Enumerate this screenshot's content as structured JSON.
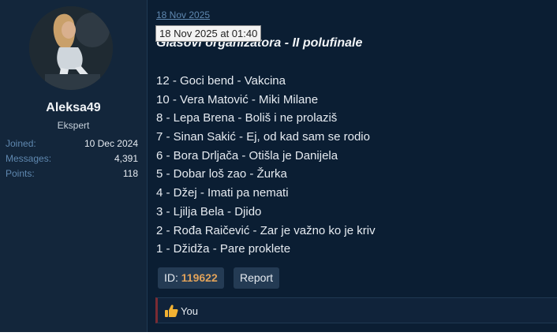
{
  "user": {
    "username": "Aleksa49",
    "title": "Ekspert",
    "stats": [
      {
        "label": "Joined:",
        "value": "10 Dec 2024"
      },
      {
        "label": "Messages:",
        "value": "4,391"
      },
      {
        "label": "Points:",
        "value": "118"
      }
    ]
  },
  "post": {
    "date": "18 Nov 2025",
    "tooltip": "18 Nov 2025 at 01:40",
    "heading": "Glasovi organizatora - II polufinale",
    "votes": [
      "12 - Goci bend - Vakcina",
      "10 - Vera Matović - Miki Milane",
      "8 - Lepa Brena - Boliš i ne prolaziš",
      "7 - Sinan Sakić - Ej, od kad sam se rodio",
      "6 - Bora Drljača - Otišla je Danijela",
      "5 - Dobar loš zao - Žurka",
      "4 - Džej - Imati pa nemati",
      "3 - Ljilja Bela - Djido",
      "2 - Rođa Raičević - Zar je važno ko je kriv",
      "1 - Džidža - Pare proklete"
    ],
    "id_label": "ID:",
    "id_value": "119622",
    "report_label": "Report"
  },
  "reactions": {
    "icon": "thumbs-up-icon",
    "users": "You"
  },
  "colors": {
    "background": "#0b1e33",
    "user_panel": "#13263b",
    "link": "#5f88b0",
    "id_accent": "#e0a25a",
    "reaction_accent": "#7a2b33"
  }
}
